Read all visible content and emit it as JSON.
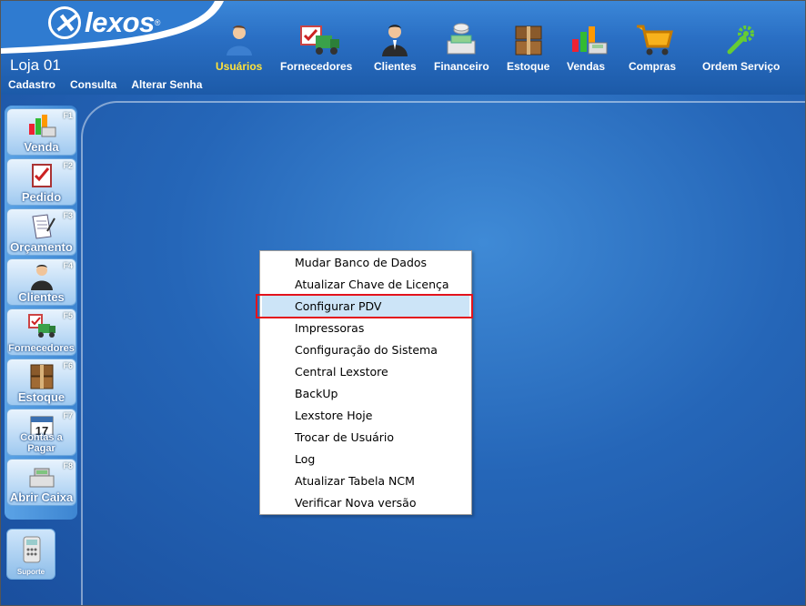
{
  "brand": {
    "name": "lexos",
    "reg": "®"
  },
  "store_label": "Loja 01",
  "menubar": [
    "Cadastro",
    "Consulta",
    "Alterar Senha"
  ],
  "modules": [
    {
      "label": "Usuários",
      "icon": "user-icon",
      "active": true
    },
    {
      "label": "Fornecedores",
      "icon": "truck-icon"
    },
    {
      "label": "Clientes",
      "icon": "customer-icon"
    },
    {
      "label": "Financeiro",
      "icon": "money-icon"
    },
    {
      "label": "Estoque",
      "icon": "box-icon"
    },
    {
      "label": "Vendas",
      "icon": "sales-chart-icon"
    },
    {
      "label": "Compras",
      "icon": "shopping-cart-icon"
    },
    {
      "label": "Ordem Serviço",
      "icon": "wrench-gear-icon"
    }
  ],
  "sidebar": [
    {
      "label": "Venda",
      "key": "F1",
      "icon": "sales-chart-icon"
    },
    {
      "label": "Pedido",
      "key": "F2",
      "icon": "checklist-icon"
    },
    {
      "label": "Orçamento",
      "key": "F3",
      "icon": "document-icon"
    },
    {
      "label": "Clientes",
      "key": "F4",
      "icon": "customer-icon"
    },
    {
      "label": "Fornecedores",
      "key": "F5",
      "icon": "truck-icon"
    },
    {
      "label": "Estoque",
      "key": "F6",
      "icon": "box-icon"
    },
    {
      "label": "Contas a Pagar",
      "key": "F7",
      "icon": "calendar-icon"
    },
    {
      "label": "Abrir Caixa",
      "key": "F8",
      "icon": "cash-register-icon"
    }
  ],
  "support": {
    "label": "Suporte",
    "icon": "phone-icon"
  },
  "context_menu": {
    "items": [
      "Mudar Banco de Dados",
      "Atualizar Chave de Licença",
      "Configurar PDV",
      "Impressoras",
      "Configuração do Sistema",
      "Central Lexstore",
      "BackUp",
      "Lexstore Hoje",
      "Trocar de Usuário",
      "Log",
      "Atualizar Tabela NCM",
      "Verificar Nova versão"
    ],
    "highlighted": "Configurar PDV"
  },
  "colors": {
    "active_module": "#ffe23a",
    "highlight_border": "#e3131c",
    "menu_hover": "#cce4f7"
  }
}
